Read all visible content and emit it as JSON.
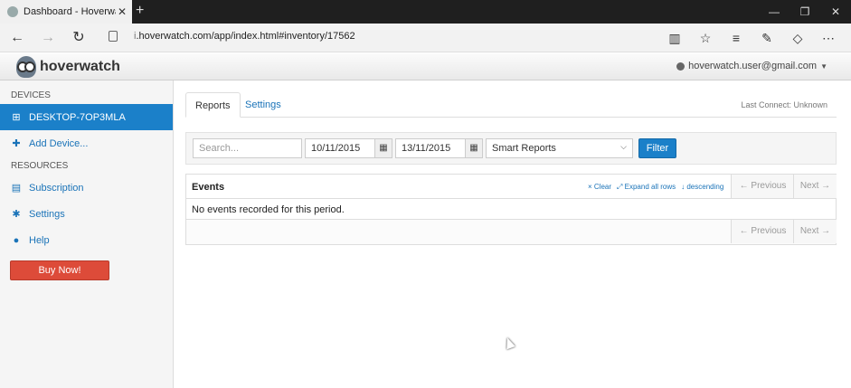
{
  "browser": {
    "tab_title": "Dashboard - Hoverwatch",
    "tab_close": "✕",
    "new_tab": "+",
    "url_prefix": "i",
    "url": ".hoverwatch.com/app/index.html#inventory/17562",
    "window_buttons": [
      "—",
      "❐",
      "✕"
    ],
    "nav": {
      "back": "←",
      "forward": "→",
      "refresh": "↻"
    },
    "right_icons": [
      "▥",
      "☆",
      "≡",
      "✎",
      "◇",
      "⋯"
    ]
  },
  "header": {
    "brand": "hoverwatch",
    "user_email": "hoverwatch.user@gmail.com",
    "caret": "▼"
  },
  "sidebar": {
    "devices_heading": "DEVICES",
    "device": "DESKTOP-7OP3MLA",
    "add_device": "Add Device...",
    "resources_heading": "RESOURCES",
    "subscription": "Subscription",
    "settings": "Settings",
    "help": "Help",
    "buy_now": "Buy Now!"
  },
  "main": {
    "tabs": [
      {
        "label": "Reports"
      },
      {
        "label": "Settings"
      }
    ],
    "last_connect": "Last Connect: Unknown",
    "filters": {
      "search_placeholder": "Search...",
      "date_from": "10/11/2015",
      "date_to": "13/11/2015",
      "report_select": "Smart Reports",
      "filter_button": "Filter"
    },
    "events": {
      "title": "Events",
      "clear": "× Clear",
      "expand": "⤢ Expand all rows",
      "order": "↓ descending",
      "previous": "← Previous",
      "next": "Next →",
      "empty_message": "No events recorded for this period."
    }
  },
  "colors": {
    "accent": "#1b80c9",
    "buy": "#dd4b39"
  }
}
